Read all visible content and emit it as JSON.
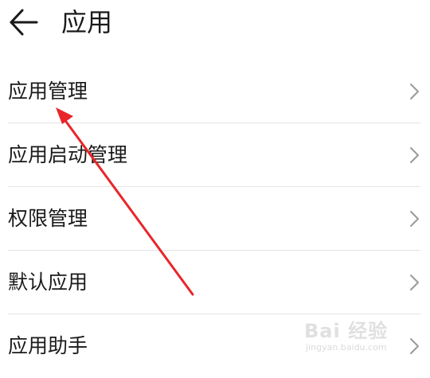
{
  "header": {
    "title": "应用",
    "back_icon": "arrow-left-icon"
  },
  "menu": {
    "items": [
      {
        "label": "应用管理",
        "icon": "chevron-right-icon"
      },
      {
        "label": "应用启动管理",
        "icon": "chevron-right-icon"
      },
      {
        "label": "权限管理",
        "icon": "chevron-right-icon"
      },
      {
        "label": "默认应用",
        "icon": "chevron-right-icon"
      },
      {
        "label": "应用助手",
        "icon": "chevron-right-icon"
      }
    ]
  },
  "annotation": {
    "type": "arrow",
    "color": "#e8262a",
    "points_to": "应用管理"
  },
  "watermark": {
    "brand": "Bai  经验",
    "url": "jingyan.baidu.com"
  },
  "colors": {
    "divider": "#e4e4e4",
    "chevron": "#9a9a9a",
    "text": "#1a1a1a"
  }
}
